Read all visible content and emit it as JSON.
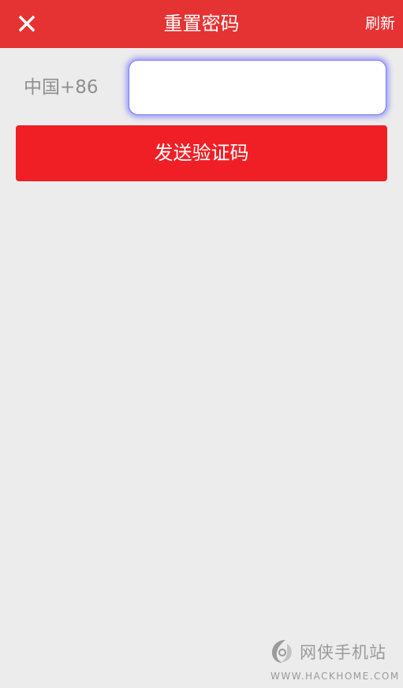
{
  "header": {
    "title": "重置密码",
    "refresh_label": "刷新",
    "close_icon": "close-icon",
    "background_color": "#e53232"
  },
  "form": {
    "country_code_label": "中国+86",
    "phone_value": "",
    "send_code_label": "发送验证码",
    "button_color": "#f01f26"
  },
  "watermark": {
    "logo_icon": "hackhome-logo-icon",
    "site_name": "网侠手机站",
    "site_url": "WWW.HACKHOME.COM"
  }
}
